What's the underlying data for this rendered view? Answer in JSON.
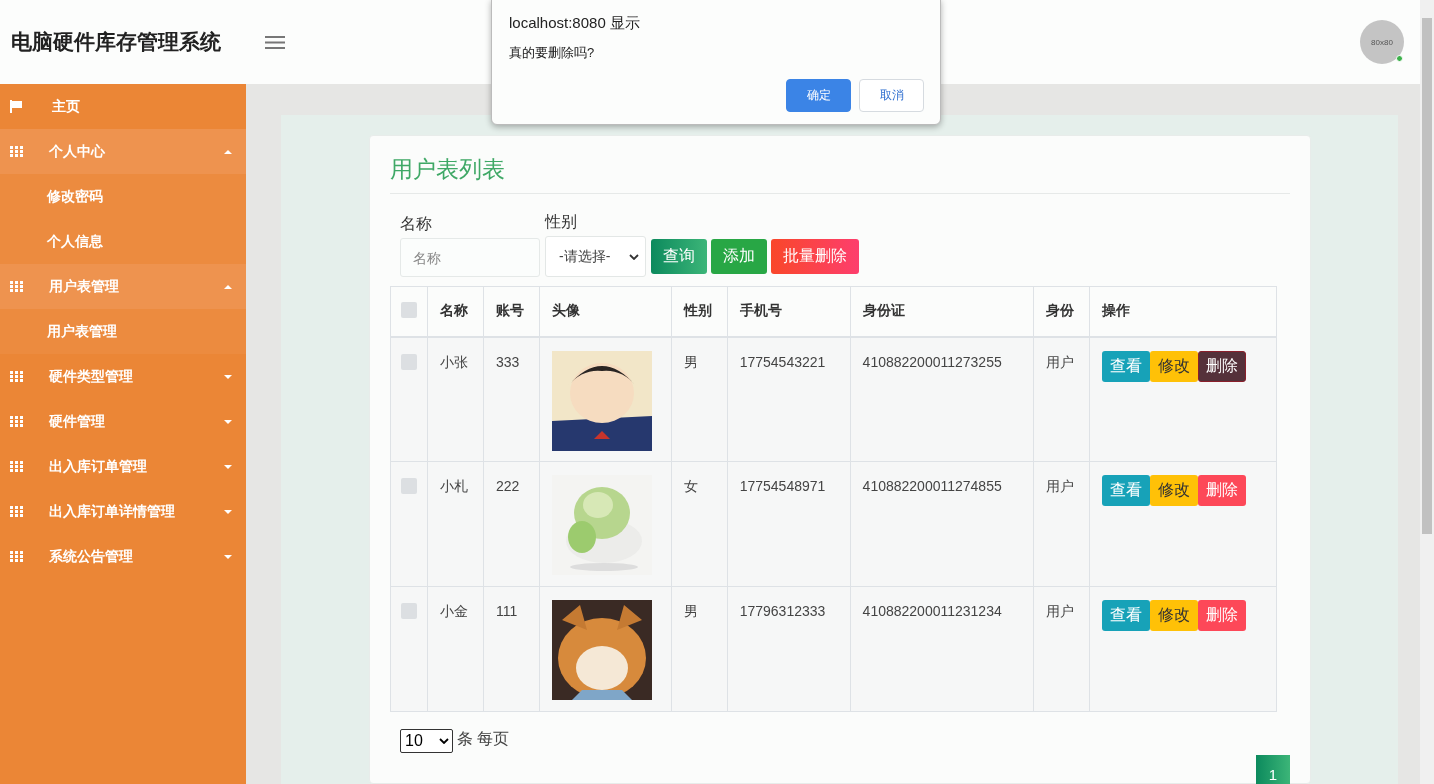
{
  "header": {
    "title": "电脑硬件库存管理系统",
    "avatar_text": "80x80",
    "online": true
  },
  "sidebar": {
    "items": [
      {
        "kind": "link",
        "label": "主页"
      },
      {
        "kind": "group",
        "label": "个人中心",
        "expanded": true,
        "children": [
          {
            "label": "修改密码"
          },
          {
            "label": "个人信息"
          }
        ]
      },
      {
        "kind": "group",
        "label": "用户表管理",
        "expanded": true,
        "children": [
          {
            "label": "用户表管理"
          }
        ]
      },
      {
        "kind": "group",
        "label": "硬件类型管理",
        "expanded": false
      },
      {
        "kind": "group",
        "label": "硬件管理",
        "expanded": false
      },
      {
        "kind": "group",
        "label": "出入库订单管理",
        "expanded": false
      },
      {
        "kind": "group",
        "label": "出入库订单详情管理",
        "expanded": false
      },
      {
        "kind": "group",
        "label": "系统公告管理",
        "expanded": false
      }
    ]
  },
  "page": {
    "title": "用户表列表",
    "filters": [
      {
        "kind": "text",
        "label": "名称",
        "placeholder": "名称"
      },
      {
        "kind": "select",
        "label": "性别",
        "value": "-请选择-"
      }
    ],
    "buttons": [
      {
        "kind": "search",
        "label": "查询"
      },
      {
        "kind": "add",
        "label": "添加"
      },
      {
        "kind": "danger",
        "label": "批量删除"
      }
    ],
    "table": {
      "columns": [
        "名称",
        "账号",
        "头像",
        "性别",
        "手机号",
        "身份证",
        "身份",
        "操作"
      ],
      "all_checked": false,
      "rows": [
        {
          "checked": false,
          "name": "小张",
          "account": "333",
          "gender": "男",
          "phone": "17754543221",
          "id_card": "410882200011273255",
          "role": "用户",
          "actions": [
            {
              "kind": "view",
              "label": "查看",
              "pressed": false
            },
            {
              "kind": "edit",
              "label": "修改",
              "pressed": false
            },
            {
              "kind": "delete",
              "label": "删除",
              "pressed": true
            }
          ]
        },
        {
          "checked": false,
          "name": "小札",
          "account": "222",
          "gender": "女",
          "phone": "17754548971",
          "id_card": "410882200011274855",
          "role": "用户",
          "actions": [
            {
              "kind": "view",
              "label": "查看",
              "pressed": false
            },
            {
              "kind": "edit",
              "label": "修改",
              "pressed": false
            },
            {
              "kind": "delete",
              "label": "删除",
              "pressed": false
            }
          ]
        },
        {
          "checked": false,
          "name": "小金",
          "account": "111",
          "gender": "男",
          "phone": "17796312333",
          "id_card": "410882200011231234",
          "role": "用户",
          "actions": [
            {
              "kind": "view",
              "label": "查看",
              "pressed": false
            },
            {
              "kind": "edit",
              "label": "修改",
              "pressed": false
            },
            {
              "kind": "delete",
              "label": "删除",
              "pressed": false
            }
          ]
        }
      ]
    },
    "page_size": {
      "value": "10",
      "label": "条 每页"
    },
    "pagination": [
      {
        "label": "1",
        "selected": true
      }
    ]
  },
  "dialog": {
    "title": "localhost:8080 显示",
    "message": "真的要删除吗?",
    "buttons": [
      {
        "kind": "primary",
        "label": "确定"
      },
      {
        "kind": "secondary",
        "label": "取消"
      }
    ]
  }
}
